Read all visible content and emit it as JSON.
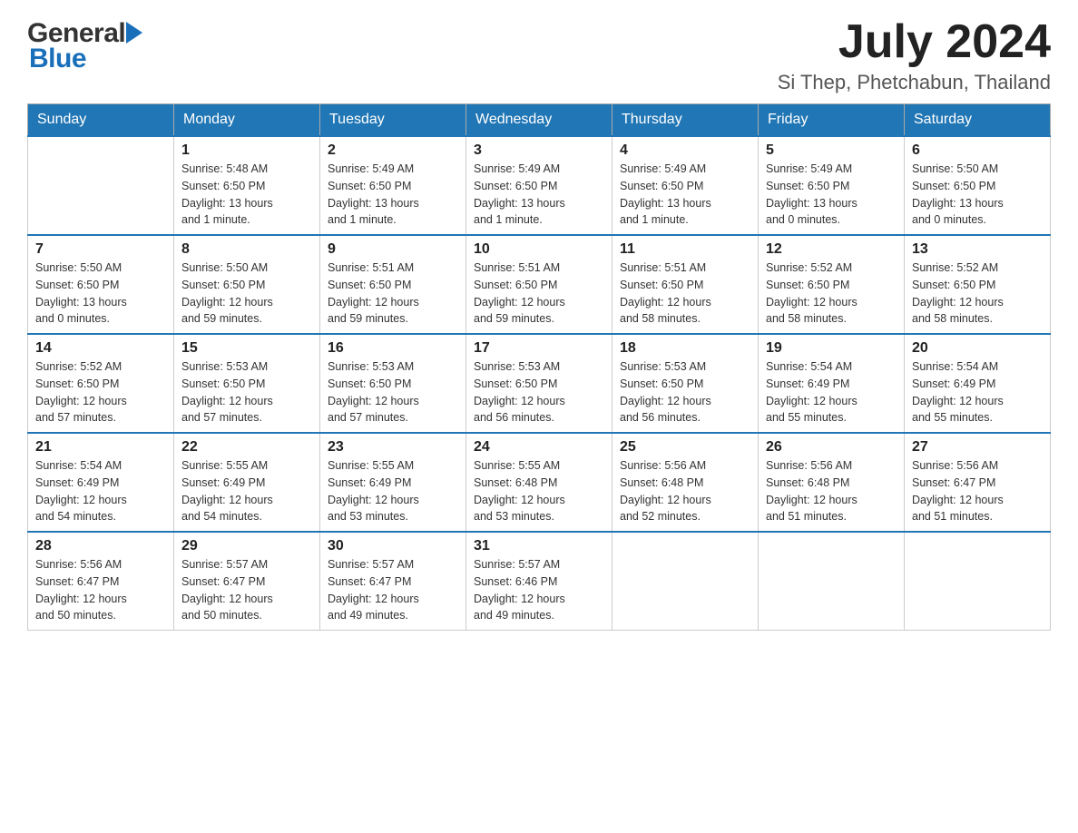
{
  "header": {
    "logo": {
      "general": "General",
      "blue": "Blue"
    },
    "month_year": "July 2024",
    "location": "Si Thep, Phetchabun, Thailand"
  },
  "weekdays": [
    "Sunday",
    "Monday",
    "Tuesday",
    "Wednesday",
    "Thursday",
    "Friday",
    "Saturday"
  ],
  "weeks": [
    [
      {
        "day": "",
        "info": ""
      },
      {
        "day": "1",
        "info": "Sunrise: 5:48 AM\nSunset: 6:50 PM\nDaylight: 13 hours\nand 1 minute."
      },
      {
        "day": "2",
        "info": "Sunrise: 5:49 AM\nSunset: 6:50 PM\nDaylight: 13 hours\nand 1 minute."
      },
      {
        "day": "3",
        "info": "Sunrise: 5:49 AM\nSunset: 6:50 PM\nDaylight: 13 hours\nand 1 minute."
      },
      {
        "day": "4",
        "info": "Sunrise: 5:49 AM\nSunset: 6:50 PM\nDaylight: 13 hours\nand 1 minute."
      },
      {
        "day": "5",
        "info": "Sunrise: 5:49 AM\nSunset: 6:50 PM\nDaylight: 13 hours\nand 0 minutes."
      },
      {
        "day": "6",
        "info": "Sunrise: 5:50 AM\nSunset: 6:50 PM\nDaylight: 13 hours\nand 0 minutes."
      }
    ],
    [
      {
        "day": "7",
        "info": "Sunrise: 5:50 AM\nSunset: 6:50 PM\nDaylight: 13 hours\nand 0 minutes."
      },
      {
        "day": "8",
        "info": "Sunrise: 5:50 AM\nSunset: 6:50 PM\nDaylight: 12 hours\nand 59 minutes."
      },
      {
        "day": "9",
        "info": "Sunrise: 5:51 AM\nSunset: 6:50 PM\nDaylight: 12 hours\nand 59 minutes."
      },
      {
        "day": "10",
        "info": "Sunrise: 5:51 AM\nSunset: 6:50 PM\nDaylight: 12 hours\nand 59 minutes."
      },
      {
        "day": "11",
        "info": "Sunrise: 5:51 AM\nSunset: 6:50 PM\nDaylight: 12 hours\nand 58 minutes."
      },
      {
        "day": "12",
        "info": "Sunrise: 5:52 AM\nSunset: 6:50 PM\nDaylight: 12 hours\nand 58 minutes."
      },
      {
        "day": "13",
        "info": "Sunrise: 5:52 AM\nSunset: 6:50 PM\nDaylight: 12 hours\nand 58 minutes."
      }
    ],
    [
      {
        "day": "14",
        "info": "Sunrise: 5:52 AM\nSunset: 6:50 PM\nDaylight: 12 hours\nand 57 minutes."
      },
      {
        "day": "15",
        "info": "Sunrise: 5:53 AM\nSunset: 6:50 PM\nDaylight: 12 hours\nand 57 minutes."
      },
      {
        "day": "16",
        "info": "Sunrise: 5:53 AM\nSunset: 6:50 PM\nDaylight: 12 hours\nand 57 minutes."
      },
      {
        "day": "17",
        "info": "Sunrise: 5:53 AM\nSunset: 6:50 PM\nDaylight: 12 hours\nand 56 minutes."
      },
      {
        "day": "18",
        "info": "Sunrise: 5:53 AM\nSunset: 6:50 PM\nDaylight: 12 hours\nand 56 minutes."
      },
      {
        "day": "19",
        "info": "Sunrise: 5:54 AM\nSunset: 6:49 PM\nDaylight: 12 hours\nand 55 minutes."
      },
      {
        "day": "20",
        "info": "Sunrise: 5:54 AM\nSunset: 6:49 PM\nDaylight: 12 hours\nand 55 minutes."
      }
    ],
    [
      {
        "day": "21",
        "info": "Sunrise: 5:54 AM\nSunset: 6:49 PM\nDaylight: 12 hours\nand 54 minutes."
      },
      {
        "day": "22",
        "info": "Sunrise: 5:55 AM\nSunset: 6:49 PM\nDaylight: 12 hours\nand 54 minutes."
      },
      {
        "day": "23",
        "info": "Sunrise: 5:55 AM\nSunset: 6:49 PM\nDaylight: 12 hours\nand 53 minutes."
      },
      {
        "day": "24",
        "info": "Sunrise: 5:55 AM\nSunset: 6:48 PM\nDaylight: 12 hours\nand 53 minutes."
      },
      {
        "day": "25",
        "info": "Sunrise: 5:56 AM\nSunset: 6:48 PM\nDaylight: 12 hours\nand 52 minutes."
      },
      {
        "day": "26",
        "info": "Sunrise: 5:56 AM\nSunset: 6:48 PM\nDaylight: 12 hours\nand 51 minutes."
      },
      {
        "day": "27",
        "info": "Sunrise: 5:56 AM\nSunset: 6:47 PM\nDaylight: 12 hours\nand 51 minutes."
      }
    ],
    [
      {
        "day": "28",
        "info": "Sunrise: 5:56 AM\nSunset: 6:47 PM\nDaylight: 12 hours\nand 50 minutes."
      },
      {
        "day": "29",
        "info": "Sunrise: 5:57 AM\nSunset: 6:47 PM\nDaylight: 12 hours\nand 50 minutes."
      },
      {
        "day": "30",
        "info": "Sunrise: 5:57 AM\nSunset: 6:47 PM\nDaylight: 12 hours\nand 49 minutes."
      },
      {
        "day": "31",
        "info": "Sunrise: 5:57 AM\nSunset: 6:46 PM\nDaylight: 12 hours\nand 49 minutes."
      },
      {
        "day": "",
        "info": ""
      },
      {
        "day": "",
        "info": ""
      },
      {
        "day": "",
        "info": ""
      }
    ]
  ]
}
